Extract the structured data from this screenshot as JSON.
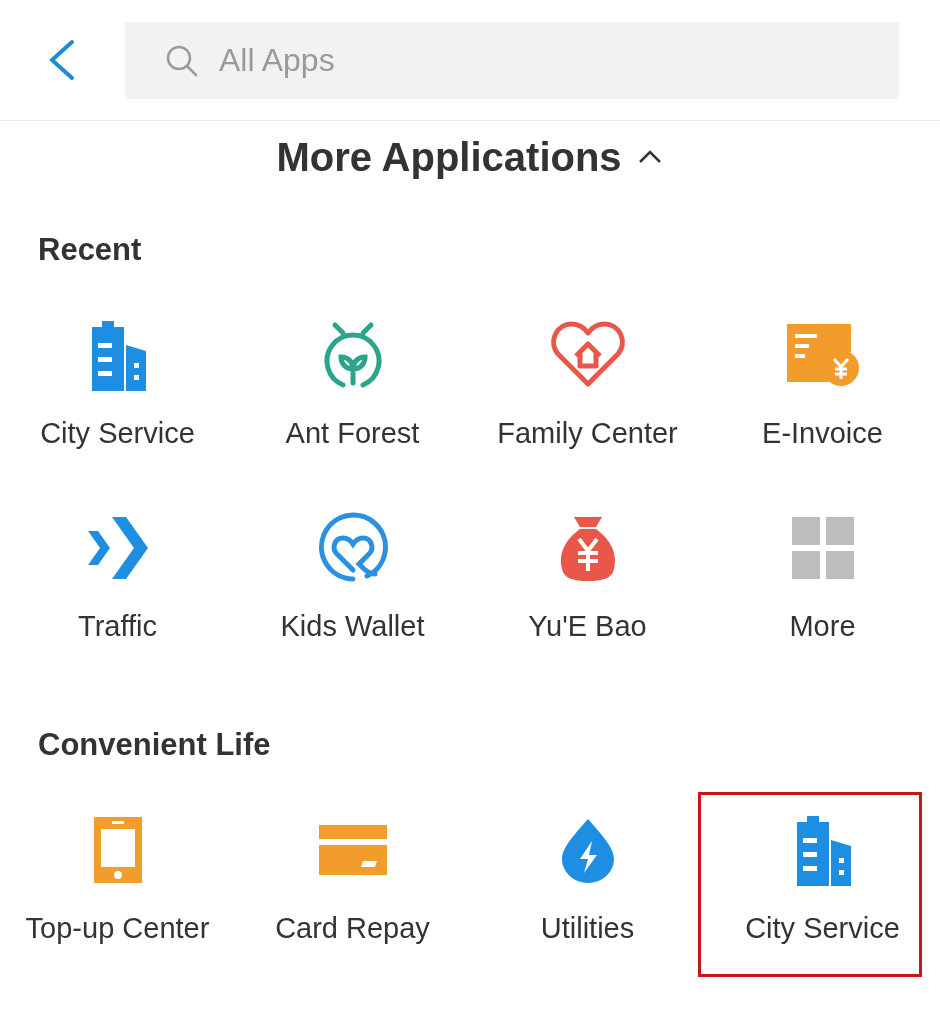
{
  "search": {
    "placeholder": "All Apps"
  },
  "title": {
    "text": "More Applications",
    "expanded": true
  },
  "sections": [
    {
      "heading": "Recent",
      "apps": [
        {
          "label": "City Service",
          "kind": "building",
          "highlighted": false
        },
        {
          "label": "Ant Forest",
          "kind": "sprout",
          "highlighted": false
        },
        {
          "label": "Family Center",
          "kind": "heart",
          "highlighted": false
        },
        {
          "label": "E-Invoice",
          "kind": "invoice",
          "highlighted": false
        },
        {
          "label": "Traffic",
          "kind": "chevrons",
          "highlighted": false
        },
        {
          "label": "Kids Wallet",
          "kind": "ring",
          "highlighted": false
        },
        {
          "label": "Yu'E Bao",
          "kind": "bag",
          "highlighted": false
        },
        {
          "label": "More",
          "kind": "grid",
          "highlighted": false
        }
      ]
    },
    {
      "heading": "Convenient Life",
      "apps": [
        {
          "label": "Top-up Center",
          "kind": "phone",
          "highlighted": false
        },
        {
          "label": "Card Repay",
          "kind": "card",
          "highlighted": false
        },
        {
          "label": "Utilities",
          "kind": "drop",
          "highlighted": false
        },
        {
          "label": "City Service",
          "kind": "building",
          "highlighted": true
        }
      ]
    }
  ]
}
